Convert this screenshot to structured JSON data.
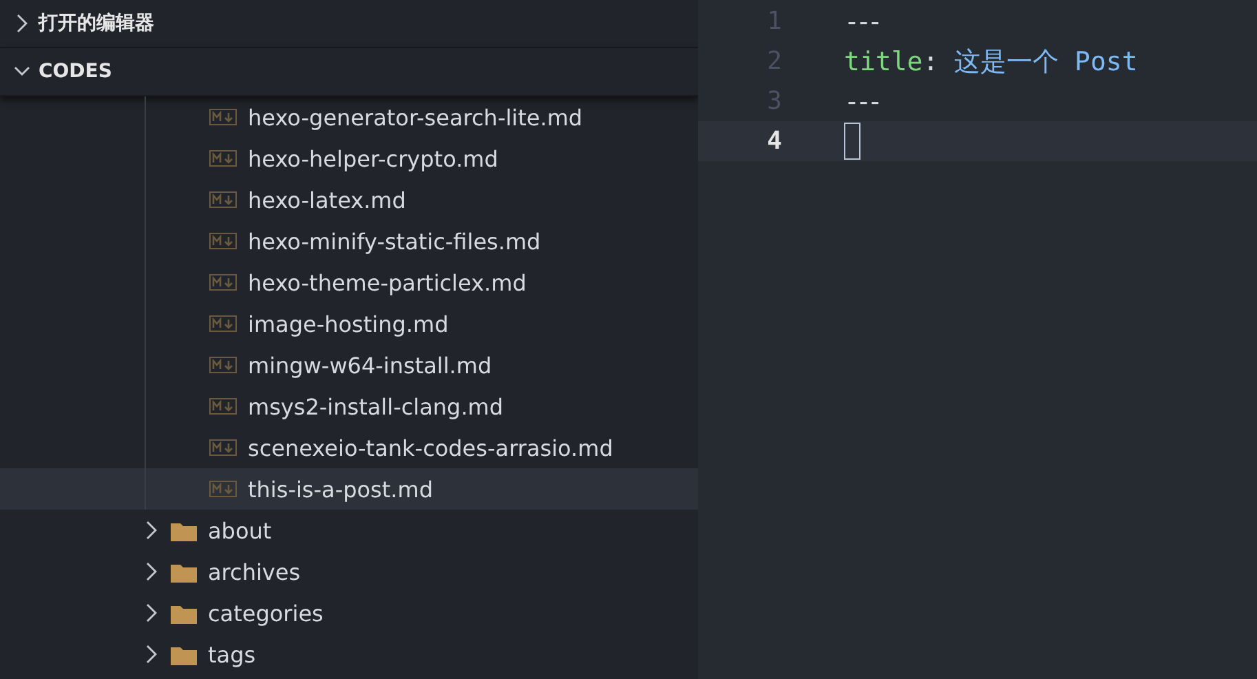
{
  "sections": [
    {
      "label": "打开的编辑器",
      "expanded": false
    },
    {
      "label": "CODES",
      "expanded": true
    }
  ],
  "tree": {
    "files": [
      {
        "label": "hexo-generator-search-lite.md",
        "selected": false
      },
      {
        "label": "hexo-helper-crypto.md",
        "selected": false
      },
      {
        "label": "hexo-latex.md",
        "selected": false
      },
      {
        "label": "hexo-minify-static-files.md",
        "selected": false
      },
      {
        "label": "hexo-theme-particlex.md",
        "selected": false
      },
      {
        "label": "image-hosting.md",
        "selected": false
      },
      {
        "label": "mingw-w64-install.md",
        "selected": false
      },
      {
        "label": "msys2-install-clang.md",
        "selected": false
      },
      {
        "label": "scenexeio-tank-codes-arrasio.md",
        "selected": false
      },
      {
        "label": "this-is-a-post.md",
        "selected": true
      }
    ],
    "folders": [
      {
        "label": "about",
        "expanded": false
      },
      {
        "label": "archives",
        "expanded": false
      },
      {
        "label": "categories",
        "expanded": false
      },
      {
        "label": "tags",
        "expanded": false
      }
    ]
  },
  "editor": {
    "lines": [
      {
        "number": "1",
        "current": false,
        "tokens": [
          {
            "kind": "rule",
            "text": "---"
          }
        ]
      },
      {
        "number": "2",
        "current": false,
        "tokens": [
          {
            "kind": "key",
            "text": "title"
          },
          {
            "kind": "punct",
            "text": ": "
          },
          {
            "kind": "value",
            "text": "这是一个 Post"
          }
        ]
      },
      {
        "number": "3",
        "current": false,
        "tokens": [
          {
            "kind": "rule",
            "text": "---"
          }
        ]
      },
      {
        "number": "4",
        "current": true
      }
    ]
  }
}
